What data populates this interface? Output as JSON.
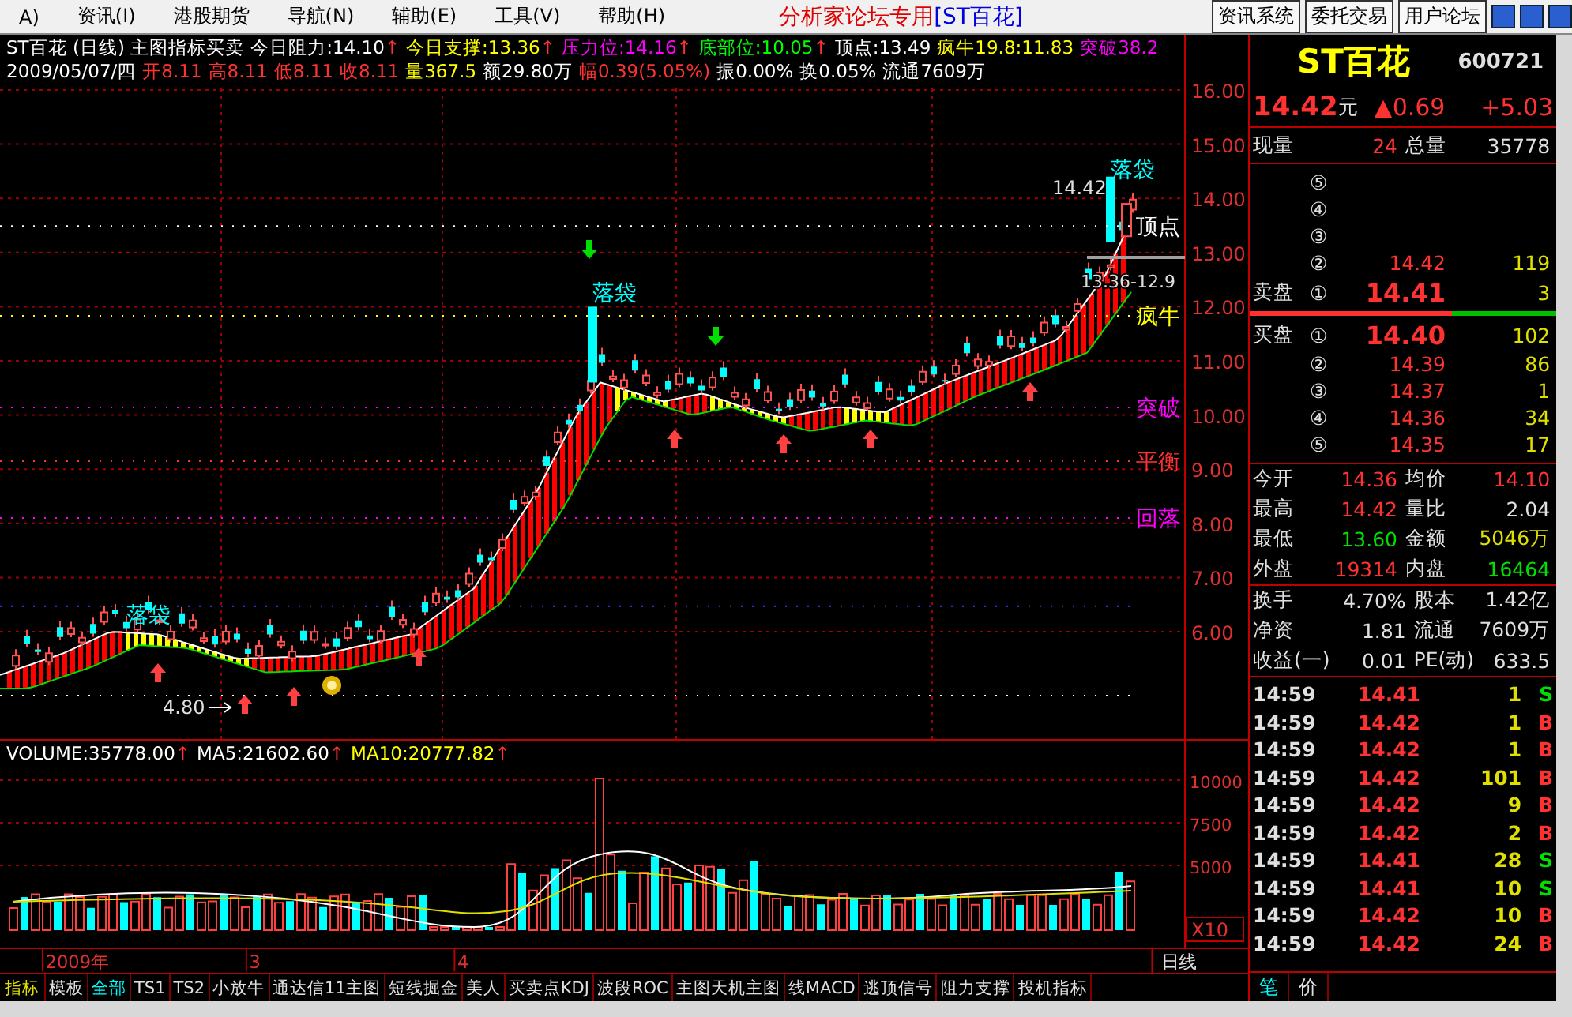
{
  "menu": {
    "items": [
      "A)",
      "资讯(I)",
      "港股期货",
      "导航(N)",
      "辅助(E)",
      "工具(V)",
      "帮助(H)"
    ]
  },
  "window": {
    "title": "分析家论坛专用",
    "title_stock": "[ST百花]",
    "buttons": [
      "资讯系统",
      "委托交易",
      "用户论坛"
    ]
  },
  "price_chart": {
    "header_line_1": [
      {
        "text": "ST百花 (日线) 主图指标买卖",
        "color": "#ffffff"
      },
      {
        "text": "今日阻力:14.10",
        "color": "#ffffff",
        "arrow": "↑"
      },
      {
        "text": "今日支撑:13.36",
        "color": "#ffff00",
        "arrow": "↑"
      },
      {
        "text": "压力位:14.16",
        "color": "#ff00ff",
        "arrow": "↑"
      },
      {
        "text": "底部位:10.05",
        "color": "#00ff00",
        "arrow": "↑"
      },
      {
        "text": "顶点:13.49",
        "color": "#ffffff"
      },
      {
        "text": "疯牛19.8:11.83",
        "color": "#ffff00"
      },
      {
        "text": "突破38.2",
        "color": "#ff00ff"
      }
    ],
    "header_line_2": [
      {
        "text": "2009/05/07/四",
        "color": "#ffffff"
      },
      {
        "text": "开8.11",
        "color": "#ff3232"
      },
      {
        "text": "高8.11",
        "color": "#ff3232"
      },
      {
        "text": "低8.11",
        "color": "#ff3232"
      },
      {
        "text": "收8.11",
        "color": "#ff3232"
      },
      {
        "text": "量367.5",
        "color": "#ffff00"
      },
      {
        "text": "额29.80万",
        "color": "#ffffff"
      },
      {
        "text": "幅0.39(5.05%)",
        "color": "#ff3232"
      },
      {
        "text": "振0.00%",
        "color": "#ffffff"
      },
      {
        "text": "换0.05%",
        "color": "#ffffff"
      },
      {
        "text": "流通7609万",
        "color": "#ffffff"
      }
    ],
    "axis_labels": [
      "16.00",
      "15.00",
      "14.00",
      "13.00",
      "12.00",
      "11.00",
      "10.00",
      "9.00",
      "8.00",
      "7.00",
      "6.00"
    ],
    "signal_labels": [
      "落袋",
      "落袋",
      "落袋"
    ],
    "level_labels": [
      {
        "text": "顶点",
        "color": "#ffffff"
      },
      {
        "text": "疯牛",
        "color": "#ffff00"
      },
      {
        "text": "突破",
        "color": "#ff00ff"
      },
      {
        "text": "平衡",
        "color": "#ff3232"
      },
      {
        "text": "回落",
        "color": "#ff00ff"
      }
    ],
    "price_marks": [
      "14.42",
      "13.36-12.9",
      "4.80"
    ]
  },
  "volume_chart": {
    "header": [
      {
        "text": "VOLUME:35778.00",
        "color": "#ffffff",
        "arrow": "↑"
      },
      {
        "text": "MA5:21602.60",
        "color": "#ffffff",
        "arrow": "↑"
      },
      {
        "text": "MA10:20777.82",
        "color": "#ffff00",
        "arrow": "↑"
      }
    ],
    "axis_labels": [
      "10000",
      "7500",
      "5000"
    ],
    "scale_label": "X10"
  },
  "date_axis": {
    "labels": [
      "2009年",
      "3",
      "4"
    ],
    "period": "日线"
  },
  "indicator_tabs": {
    "group_label": "指标",
    "tabs": [
      {
        "label": "模板",
        "selected": false
      },
      {
        "label": "全部",
        "selected": true
      },
      {
        "label": "TS1",
        "selected": false
      },
      {
        "label": "TS2",
        "selected": false
      },
      {
        "label": "小放牛",
        "selected": false
      },
      {
        "label": "通达信11主图",
        "selected": false
      },
      {
        "label": "短线掘金",
        "selected": false
      },
      {
        "label": "美人",
        "selected": false
      },
      {
        "label": "买卖点KDJ",
        "selected": false
      },
      {
        "label": "波段ROC",
        "selected": false
      },
      {
        "label": "主图天机主图",
        "selected": false
      },
      {
        "label": "线MACD",
        "selected": false
      },
      {
        "label": "逃顶信号",
        "selected": false
      },
      {
        "label": "阻力支撑",
        "selected": false
      },
      {
        "label": "投机指标",
        "selected": false
      }
    ]
  },
  "quote": {
    "name": "ST百花",
    "code": "600721",
    "price": "14.42",
    "unit": "元",
    "change": "▲0.69",
    "change_pct": "+5.03",
    "volume_row": [
      {
        "label": "现量",
        "value": "24",
        "color": "#ff3232"
      },
      {
        "label": "总量",
        "value": "35778",
        "color": "#e0e0e0"
      }
    ]
  },
  "order_book": {
    "asks": [
      {
        "level": "⑤"
      },
      {
        "level": "④"
      },
      {
        "level": "③"
      },
      {
        "level": "②",
        "price": "14.42",
        "volume": "119"
      },
      {
        "level": "①",
        "side_label": "卖盘",
        "price": "14.41",
        "volume": "3"
      }
    ],
    "ratio": {
      "level": 0.66
    },
    "bids": [
      {
        "level": "①",
        "side_label": "买盘",
        "price": "14.40",
        "volume": "102"
      },
      {
        "level": "②",
        "price": "14.39",
        "volume": "86"
      },
      {
        "level": "③",
        "price": "14.37",
        "volume": "1"
      },
      {
        "level": "④",
        "price": "14.36",
        "volume": "34"
      },
      {
        "level": "⑤",
        "price": "14.35",
        "volume": "17"
      }
    ]
  },
  "stats": [
    {
      "label": "今开",
      "value": "14.36",
      "color": "#ff3232"
    },
    {
      "label": "均价",
      "value": "14.10",
      "color": "#ff3232"
    },
    {
      "label": "最高",
      "value": "14.42",
      "color": "#ff3232"
    },
    {
      "label": "量比",
      "value": "2.04",
      "color": "#e0e0e0"
    },
    {
      "label": "最低",
      "value": "13.60",
      "color": "#00e000"
    },
    {
      "label": "金额",
      "value": "5046万",
      "color": "#e0e000"
    },
    {
      "label": "外盘",
      "value": "19314",
      "color": "#ff3232"
    },
    {
      "label": "内盘",
      "value": "16464",
      "color": "#00e000"
    }
  ],
  "fundamentals": [
    {
      "label": "换手",
      "value": "4.70%"
    },
    {
      "label": "股本",
      "value": "1.42亿"
    },
    {
      "label": "净资",
      "value": "1.81"
    },
    {
      "label": "流通",
      "value": "7609万"
    },
    {
      "label": "收益(一)",
      "value": "0.01"
    },
    {
      "label": "PE(动)",
      "value": "633.5"
    }
  ],
  "ticks": [
    {
      "time": "14:59",
      "price": "14.41",
      "volume": "1",
      "side": "S",
      "kind": "sell"
    },
    {
      "time": "14:59",
      "price": "14.42",
      "volume": "1",
      "side": "B",
      "kind": "buy"
    },
    {
      "time": "14:59",
      "price": "14.42",
      "volume": "1",
      "side": "B",
      "kind": "buy"
    },
    {
      "time": "14:59",
      "price": "14.42",
      "volume": "101",
      "side": "B",
      "kind": "buy"
    },
    {
      "time": "14:59",
      "price": "14.42",
      "volume": "9",
      "side": "B",
      "kind": "buy"
    },
    {
      "time": "14:59",
      "price": "14.42",
      "volume": "2",
      "side": "B",
      "kind": "buy"
    },
    {
      "time": "14:59",
      "price": "14.41",
      "volume": "28",
      "side": "S",
      "kind": "sell"
    },
    {
      "time": "14:59",
      "price": "14.41",
      "volume": "10",
      "side": "S",
      "kind": "sell"
    },
    {
      "time": "14:59",
      "price": "14.42",
      "volume": "10",
      "side": "B",
      "kind": "buy"
    },
    {
      "time": "14:59",
      "price": "14.42",
      "volume": "24",
      "side": "B",
      "kind": "buy"
    }
  ],
  "panel_tabs": [
    {
      "label": "笔",
      "selected": true
    },
    {
      "label": "价",
      "selected": false
    }
  ]
}
